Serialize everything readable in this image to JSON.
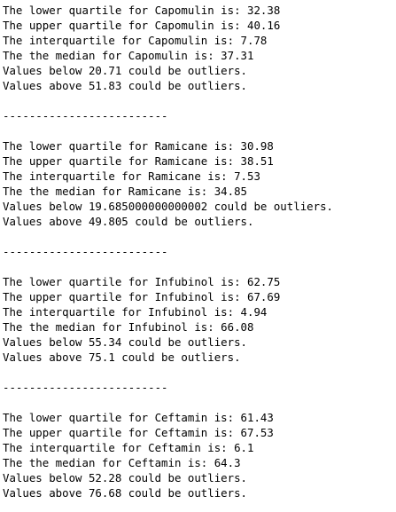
{
  "groups": [
    {
      "lines": [
        "The lower quartile for Capomulin is: 32.38",
        "The upper quartile for Capomulin is: 40.16",
        "The interquartile for Capomulin is: 7.78",
        "The the median for Capomulin is: 37.31",
        "Values below 20.71 could be outliers.",
        "Values above 51.83 could be outliers."
      ]
    },
    {
      "lines": [
        "The lower quartile for Ramicane is: 30.98",
        "The upper quartile for Ramicane is: 38.51",
        "The interquartile for Ramicane is: 7.53",
        "The the median for Ramicane is: 34.85",
        "Values below 19.685000000000002 could be outliers.",
        "Values above 49.805 could be outliers."
      ]
    },
    {
      "lines": [
        "The lower quartile for Infubinol is: 62.75",
        "The upper quartile for Infubinol is: 67.69",
        "The interquartile for Infubinol is: 4.94",
        "The the median for Infubinol is: 66.08",
        "Values below 55.34 could be outliers.",
        "Values above 75.1 could be outliers."
      ]
    },
    {
      "lines": [
        "The lower quartile for Ceftamin is: 61.43",
        "The upper quartile for Ceftamin is: 67.53",
        "The interquartile for Ceftamin is: 6.1",
        "The the median for Ceftamin is: 64.3",
        "Values below 52.28 could be outliers.",
        "Values above 76.68 could be outliers."
      ]
    }
  ],
  "separator": "-------------------------"
}
